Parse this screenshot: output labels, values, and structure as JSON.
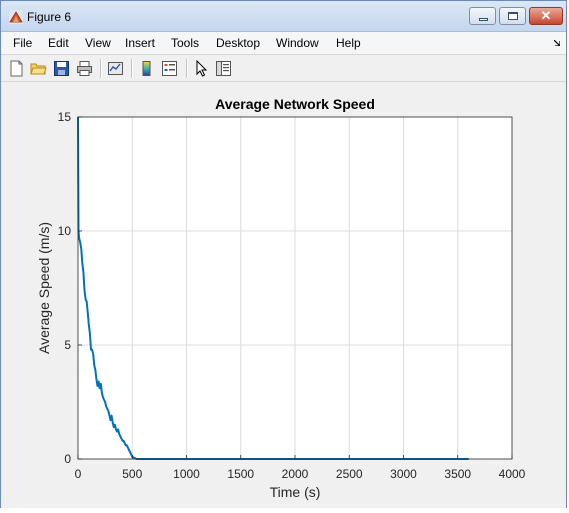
{
  "window": {
    "title": "Figure 6",
    "close_glyph": "✕"
  },
  "menu": [
    {
      "label": "File",
      "name": "menu-file"
    },
    {
      "label": "Edit",
      "name": "menu-edit"
    },
    {
      "label": "View",
      "name": "menu-view"
    },
    {
      "label": "Insert",
      "name": "menu-insert"
    },
    {
      "label": "Tools",
      "name": "menu-tools"
    },
    {
      "label": "Desktop",
      "name": "menu-desktop"
    },
    {
      "label": "Window",
      "name": "menu-window"
    },
    {
      "label": "Help",
      "name": "menu-help"
    }
  ],
  "toolbar": [
    "new-figure-icon",
    "open-file-icon",
    "save-icon",
    "print-icon",
    "link-plot-icon",
    "colorbar-icon",
    "legend-icon",
    "edit-plot-pointer-icon",
    "property-editor-icon"
  ],
  "chart_data": {
    "type": "line",
    "title": "Average Network Speed",
    "xlabel": "Time (s)",
    "ylabel": "Average Speed (m/s)",
    "xlim": [
      0,
      4000
    ],
    "ylim": [
      0,
      15
    ],
    "xticks": [
      0,
      500,
      1000,
      1500,
      2000,
      2500,
      3000,
      3500,
      4000
    ],
    "yticks": [
      0,
      5,
      10,
      15
    ],
    "grid": true,
    "series": [
      {
        "color": "#0072bd",
        "x": [
          0,
          5,
          10,
          20,
          30,
          40,
          50,
          60,
          70,
          80,
          90,
          100,
          110,
          120,
          130,
          140,
          150,
          160,
          170,
          180,
          190,
          200,
          210,
          220,
          230,
          240,
          250,
          260,
          270,
          280,
          290,
          300,
          310,
          320,
          330,
          340,
          350,
          360,
          370,
          380,
          390,
          400,
          410,
          420,
          430,
          440,
          450,
          460,
          470,
          480,
          490,
          500,
          520,
          540,
          600,
          800,
          1000,
          1500,
          2000,
          2500,
          3000,
          3500,
          3600
        ],
        "y": [
          15,
          10,
          9.7,
          9.5,
          9.2,
          8.6,
          8.2,
          7.4,
          7.0,
          6.9,
          6.4,
          5.9,
          5.5,
          4.8,
          4.8,
          4.6,
          4.1,
          3.9,
          3.5,
          3.2,
          3.4,
          3.1,
          3.3,
          2.9,
          2.7,
          2.6,
          2.5,
          2.3,
          2.2,
          2.1,
          1.9,
          1.7,
          1.9,
          1.6,
          1.4,
          1.5,
          1.3,
          1.2,
          1.3,
          1.1,
          1.0,
          0.9,
          0.8,
          0.8,
          0.7,
          0.6,
          0.6,
          0.5,
          0.4,
          0.3,
          0.2,
          0.1,
          0.05,
          0,
          0,
          0,
          0,
          0,
          0,
          0,
          0,
          0,
          0
        ]
      }
    ]
  }
}
